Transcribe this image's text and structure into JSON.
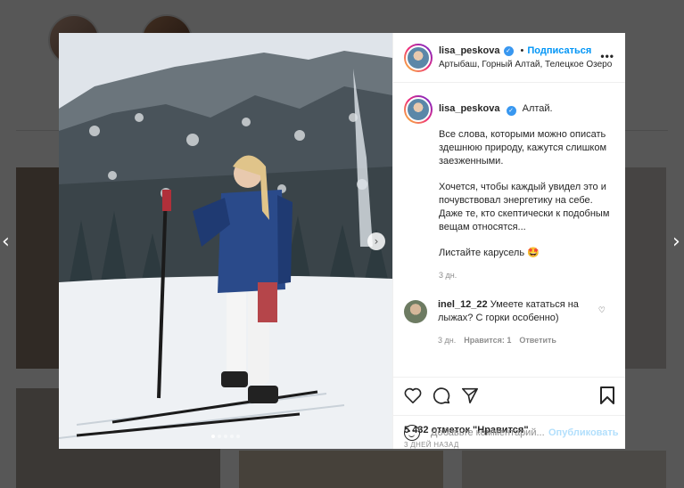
{
  "post": {
    "username": "lisa_peskova",
    "follow_label": "Подписаться",
    "separator": "•",
    "location": "Артыбаш, Горный Алтай, Телецкое Озеро",
    "more_label": "•••",
    "caption_title": "Алтай.",
    "caption_p1": "Все слова, которыми можно описать здешнюю природу, кажутся слишком заезженными.",
    "caption_p2": "Хочется, чтобы каждый увидел это и почувствовал энергетику на себе. Даже те, кто скептически к подобным вещам относятся...",
    "caption_p3": "Листайте карусель 🤩",
    "caption_time": "3 дн.",
    "likes": "5 432 отметок \"Нравится\"",
    "posted": "3 ДНЕЙ НАЗАД",
    "carousel_count": 5,
    "carousel_active": 0
  },
  "comment": {
    "username": "inel_12_22",
    "text": "Умеете кататься на лыжах? С горки особенно)",
    "time": "3 дн.",
    "likes": "Нравится: 1",
    "reply": "Ответить"
  },
  "add_comment": {
    "placeholder": "Добавьте комментарий...",
    "publish": "Опубликовать"
  },
  "icons": {
    "prev": "left-chevron-icon",
    "next": "right-chevron-icon",
    "like": "heart-icon",
    "comment": "comment-icon",
    "share": "send-icon",
    "save": "bookmark-icon",
    "emoji": "emoji-icon",
    "verified": "verified-badge-icon"
  },
  "colors": {
    "accent": "#0095f6",
    "publish_disabled": "#b2dffc",
    "verified": "#3897f0",
    "overlay": "rgba(0,0,0,0.65)"
  }
}
